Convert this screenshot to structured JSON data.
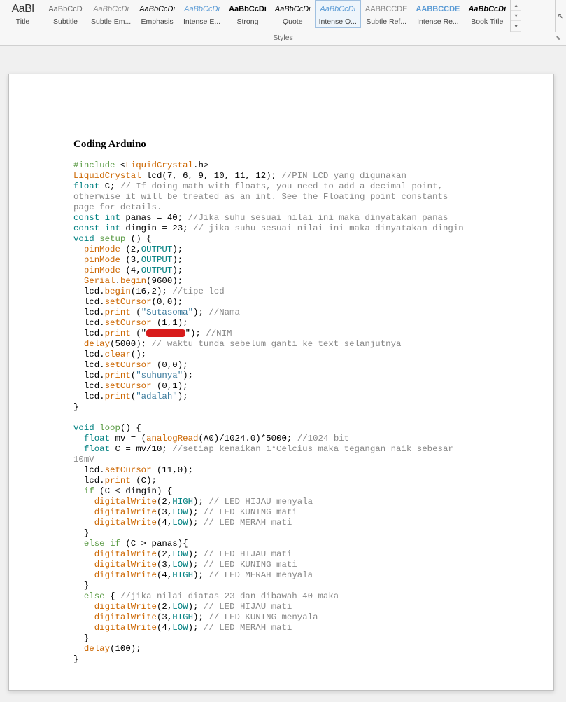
{
  "ribbon": {
    "styles": [
      {
        "preview": "AaBl",
        "cls": "title",
        "label": "Title",
        "sel": false,
        "name": "style-title"
      },
      {
        "preview": "AaBbCcD",
        "cls": "subtitle",
        "label": "Subtitle",
        "sel": false,
        "name": "style-subtitle"
      },
      {
        "preview": "AaBbCcDi",
        "cls": "subtle-em",
        "label": "Subtle Em...",
        "sel": false,
        "name": "style-subtle-emphasis"
      },
      {
        "preview": "AaBbCcDi",
        "cls": "emph",
        "label": "Emphasis",
        "sel": false,
        "name": "style-emphasis"
      },
      {
        "preview": "AaBbCcDi",
        "cls": "intense-e",
        "label": "Intense E...",
        "sel": false,
        "name": "style-intense-emphasis"
      },
      {
        "preview": "AaBbCcDi",
        "cls": "strong",
        "label": "Strong",
        "sel": false,
        "name": "style-strong"
      },
      {
        "preview": "AaBbCcDi",
        "cls": "quote",
        "label": "Quote",
        "sel": false,
        "name": "style-quote"
      },
      {
        "preview": "AaBbCcDi",
        "cls": "intense-q",
        "label": "Intense Q...",
        "sel": true,
        "name": "style-intense-quote"
      },
      {
        "preview": "AABBCCDE",
        "cls": "subtle-ref",
        "label": "Subtle Ref...",
        "sel": false,
        "name": "style-subtle-reference"
      },
      {
        "preview": "AABBCCDE",
        "cls": "intense-ref",
        "label": "Intense Re...",
        "sel": false,
        "name": "style-intense-reference"
      },
      {
        "preview": "AaBbCcDi",
        "cls": "book",
        "label": "Book Title",
        "sel": false,
        "name": "style-book-title"
      }
    ],
    "group_label": "Styles",
    "scroll_up": "▴",
    "scroll_down": "▾",
    "scroll_more": "▾",
    "launcher": "⬊",
    "select_cursor": "↖"
  },
  "doc": {
    "title": "Coding Arduino",
    "code_lines": [
      [
        {
          "t": "#include",
          "c": "kw-green"
        },
        {
          "t": " <"
        },
        {
          "t": "LiquidCrystal",
          "c": "kw-orange"
        },
        {
          "t": ".h>"
        }
      ],
      [
        {
          "t": "LiquidCrystal",
          "c": "kw-orange"
        },
        {
          "t": " lcd(7, 6, 9, 10, 11, 12); "
        },
        {
          "t": "//PIN LCD yang digunakan",
          "c": "cmt"
        }
      ],
      [
        {
          "t": "float",
          "c": "kw-teal"
        },
        {
          "t": " C; "
        },
        {
          "t": "// If doing math with floats, you need to add a decimal point,",
          "c": "cmt"
        }
      ],
      [
        {
          "t": "otherwise it will be treated as an int. See the Floating point constants",
          "c": "cmt"
        }
      ],
      [
        {
          "t": "page for details.",
          "c": "cmt"
        }
      ],
      [
        {
          "t": "const",
          "c": "kw-teal"
        },
        {
          "t": " "
        },
        {
          "t": "int",
          "c": "kw-teal"
        },
        {
          "t": " panas = 40; "
        },
        {
          "t": "//Jika suhu sesuai nilai ini maka dinyatakan panas",
          "c": "cmt"
        }
      ],
      [
        {
          "t": "const",
          "c": "kw-teal"
        },
        {
          "t": " "
        },
        {
          "t": "int",
          "c": "kw-teal"
        },
        {
          "t": " dingin = 23; "
        },
        {
          "t": "// jika suhu sesuai nilai ini maka dinyatakan dingin",
          "c": "cmt"
        }
      ],
      [
        {
          "t": "void",
          "c": "kw-teal"
        },
        {
          "t": " "
        },
        {
          "t": "setup",
          "c": "kw-green"
        },
        {
          "t": " () {"
        }
      ],
      [
        {
          "t": "  "
        },
        {
          "t": "pinMode",
          "c": "kw-orange"
        },
        {
          "t": " (2,"
        },
        {
          "t": "OUTPUT",
          "c": "kw-teal"
        },
        {
          "t": ");"
        }
      ],
      [
        {
          "t": "  "
        },
        {
          "t": "pinMode",
          "c": "kw-orange"
        },
        {
          "t": " (3,"
        },
        {
          "t": "OUTPUT",
          "c": "kw-teal"
        },
        {
          "t": ");"
        }
      ],
      [
        {
          "t": "  "
        },
        {
          "t": "pinMode",
          "c": "kw-orange"
        },
        {
          "t": " (4,"
        },
        {
          "t": "OUTPUT",
          "c": "kw-teal"
        },
        {
          "t": ");"
        }
      ],
      [
        {
          "t": "  "
        },
        {
          "t": "Serial",
          "c": "kw-orange"
        },
        {
          "t": "."
        },
        {
          "t": "begin",
          "c": "kw-orange"
        },
        {
          "t": "(9600);"
        }
      ],
      [
        {
          "t": "  lcd."
        },
        {
          "t": "begin",
          "c": "kw-orange"
        },
        {
          "t": "(16,2); "
        },
        {
          "t": "//tipe lcd",
          "c": "cmt"
        }
      ],
      [
        {
          "t": "  lcd."
        },
        {
          "t": "setCursor",
          "c": "kw-orange"
        },
        {
          "t": "(0,0);"
        }
      ],
      [
        {
          "t": "  lcd."
        },
        {
          "t": "print",
          "c": "kw-orange"
        },
        {
          "t": " ("
        },
        {
          "t": "\"Sutasoma\"",
          "c": "str"
        },
        {
          "t": "); "
        },
        {
          "t": "//Nama",
          "c": "cmt"
        }
      ],
      [
        {
          "t": "  lcd."
        },
        {
          "t": "setCursor",
          "c": "kw-orange"
        },
        {
          "t": " (1,1);"
        }
      ],
      [
        {
          "t": "  lcd."
        },
        {
          "t": "print",
          "c": "kw-orange"
        },
        {
          "t": " (\""
        },
        {
          "t": "",
          "c": "redact"
        },
        {
          "t": "\"); "
        },
        {
          "t": "//NIM",
          "c": "cmt"
        }
      ],
      [
        {
          "t": "  "
        },
        {
          "t": "delay",
          "c": "kw-orange"
        },
        {
          "t": "(5000); "
        },
        {
          "t": "// waktu tunda sebelum ganti ke text selanjutnya",
          "c": "cmt"
        }
      ],
      [
        {
          "t": "  lcd."
        },
        {
          "t": "clear",
          "c": "kw-orange"
        },
        {
          "t": "();"
        }
      ],
      [
        {
          "t": "  lcd."
        },
        {
          "t": "setCursor",
          "c": "kw-orange"
        },
        {
          "t": " (0,0);"
        }
      ],
      [
        {
          "t": "  lcd."
        },
        {
          "t": "print",
          "c": "kw-orange"
        },
        {
          "t": "("
        },
        {
          "t": "\"suhunya\"",
          "c": "str"
        },
        {
          "t": ");"
        }
      ],
      [
        {
          "t": "  lcd."
        },
        {
          "t": "setCursor",
          "c": "kw-orange"
        },
        {
          "t": " (0,1);"
        }
      ],
      [
        {
          "t": "  lcd."
        },
        {
          "t": "print",
          "c": "kw-orange"
        },
        {
          "t": "("
        },
        {
          "t": "\"adalah\"",
          "c": "str"
        },
        {
          "t": ");"
        }
      ],
      [
        {
          "t": "}"
        }
      ],
      [
        {
          "t": ""
        }
      ],
      [
        {
          "t": "void",
          "c": "kw-teal"
        },
        {
          "t": " "
        },
        {
          "t": "loop",
          "c": "kw-green"
        },
        {
          "t": "() {"
        }
      ],
      [
        {
          "t": "  "
        },
        {
          "t": "float",
          "c": "kw-teal"
        },
        {
          "t": " mv = ("
        },
        {
          "t": "analogRead",
          "c": "kw-orange"
        },
        {
          "t": "(A0)/1024.0)*5000; "
        },
        {
          "t": "//1024 bit",
          "c": "cmt"
        }
      ],
      [
        {
          "t": "  "
        },
        {
          "t": "float",
          "c": "kw-teal"
        },
        {
          "t": " C = mv/10; "
        },
        {
          "t": "//setiap kenaikan 1*Celcius maka tegangan naik sebesar",
          "c": "cmt"
        }
      ],
      [
        {
          "t": "10mV",
          "c": "cmt"
        }
      ],
      [
        {
          "t": "  lcd."
        },
        {
          "t": "setCursor",
          "c": "kw-orange"
        },
        {
          "t": " (11,0);"
        }
      ],
      [
        {
          "t": "  lcd."
        },
        {
          "t": "print",
          "c": "kw-orange"
        },
        {
          "t": " (C);"
        }
      ],
      [
        {
          "t": "  "
        },
        {
          "t": "if",
          "c": "kw-green"
        },
        {
          "t": " (C < dingin) {"
        }
      ],
      [
        {
          "t": "    "
        },
        {
          "t": "digitalWrite",
          "c": "kw-orange"
        },
        {
          "t": "(2,"
        },
        {
          "t": "HIGH",
          "c": "kw-teal"
        },
        {
          "t": "); "
        },
        {
          "t": "// LED HIJAU menyala",
          "c": "cmt"
        }
      ],
      [
        {
          "t": "    "
        },
        {
          "t": "digitalWrite",
          "c": "kw-orange"
        },
        {
          "t": "(3,"
        },
        {
          "t": "LOW",
          "c": "kw-teal"
        },
        {
          "t": "); "
        },
        {
          "t": "// LED KUNING mati",
          "c": "cmt"
        }
      ],
      [
        {
          "t": "    "
        },
        {
          "t": "digitalWrite",
          "c": "kw-orange"
        },
        {
          "t": "(4,"
        },
        {
          "t": "LOW",
          "c": "kw-teal"
        },
        {
          "t": "); "
        },
        {
          "t": "// LED MERAH mati",
          "c": "cmt"
        }
      ],
      [
        {
          "t": "  }"
        }
      ],
      [
        {
          "t": "  "
        },
        {
          "t": "else",
          "c": "kw-green"
        },
        {
          "t": " "
        },
        {
          "t": "if",
          "c": "kw-green"
        },
        {
          "t": " (C > panas){"
        }
      ],
      [
        {
          "t": "    "
        },
        {
          "t": "digitalWrite",
          "c": "kw-orange"
        },
        {
          "t": "(2,"
        },
        {
          "t": "LOW",
          "c": "kw-teal"
        },
        {
          "t": "); "
        },
        {
          "t": "// LED HIJAU mati",
          "c": "cmt"
        }
      ],
      [
        {
          "t": "    "
        },
        {
          "t": "digitalWrite",
          "c": "kw-orange"
        },
        {
          "t": "(3,"
        },
        {
          "t": "LOW",
          "c": "kw-teal"
        },
        {
          "t": "); "
        },
        {
          "t": "// LED KUNING mati",
          "c": "cmt"
        }
      ],
      [
        {
          "t": "    "
        },
        {
          "t": "digitalWrite",
          "c": "kw-orange"
        },
        {
          "t": "(4,"
        },
        {
          "t": "HIGH",
          "c": "kw-teal"
        },
        {
          "t": "); "
        },
        {
          "t": "// LED MERAH menyala",
          "c": "cmt"
        }
      ],
      [
        {
          "t": "  }"
        }
      ],
      [
        {
          "t": "  "
        },
        {
          "t": "else",
          "c": "kw-green"
        },
        {
          "t": " { "
        },
        {
          "t": "//jika nilai diatas 23 dan dibawah 40 maka",
          "c": "cmt"
        }
      ],
      [
        {
          "t": "    "
        },
        {
          "t": "digitalWrite",
          "c": "kw-orange"
        },
        {
          "t": "(2,"
        },
        {
          "t": "LOW",
          "c": "kw-teal"
        },
        {
          "t": "); "
        },
        {
          "t": "// LED HIJAU mati",
          "c": "cmt"
        }
      ],
      [
        {
          "t": "    "
        },
        {
          "t": "digitalWrite",
          "c": "kw-orange"
        },
        {
          "t": "(3,"
        },
        {
          "t": "HIGH",
          "c": "kw-teal"
        },
        {
          "t": "); "
        },
        {
          "t": "// LED KUNING menyala",
          "c": "cmt"
        }
      ],
      [
        {
          "t": "    "
        },
        {
          "t": "digitalWrite",
          "c": "kw-orange"
        },
        {
          "t": "(4,"
        },
        {
          "t": "LOW",
          "c": "kw-teal"
        },
        {
          "t": "); "
        },
        {
          "t": "// LED MERAH mati",
          "c": "cmt"
        }
      ],
      [
        {
          "t": "  }"
        }
      ],
      [
        {
          "t": "  "
        },
        {
          "t": "delay",
          "c": "kw-orange"
        },
        {
          "t": "(100);"
        }
      ],
      [
        {
          "t": "}"
        }
      ]
    ]
  }
}
